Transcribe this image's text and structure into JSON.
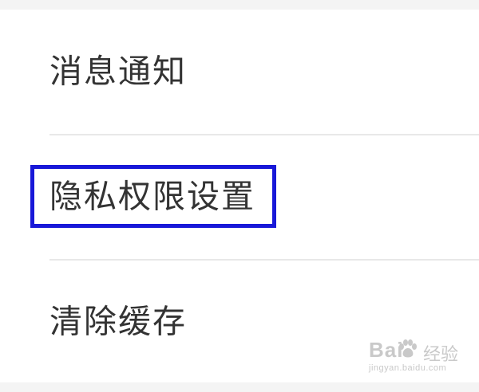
{
  "settings": {
    "items": [
      {
        "label": "消息通知"
      },
      {
        "label": "隐私权限设置"
      },
      {
        "label": "清除缓存"
      }
    ]
  },
  "watermark": {
    "brand": "Bai",
    "suffix": "经验",
    "url": "jingyan.baidu.com"
  },
  "colors": {
    "highlight_border": "#1818d8",
    "text": "#333333",
    "divider": "#e8e8e8",
    "background": "#f4f4f4"
  }
}
